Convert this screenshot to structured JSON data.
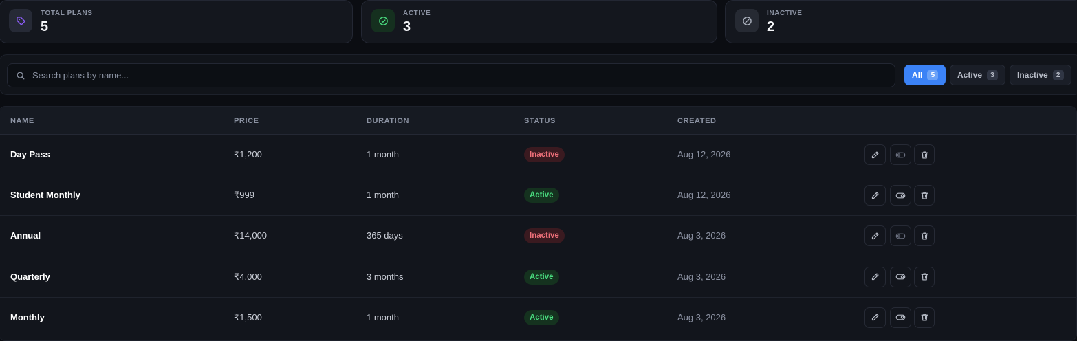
{
  "stats": [
    {
      "label": "TOTAL PLANS",
      "value": "5",
      "icon": "tag-icon",
      "accent": "#8b5cf6"
    },
    {
      "label": "ACTIVE",
      "value": "3",
      "icon": "check-circle-icon",
      "accent": "#4ade80"
    },
    {
      "label": "INACTIVE",
      "value": "2",
      "icon": "ban-circle-icon",
      "accent": "#9ca3af"
    }
  ],
  "search": {
    "placeholder": "Search plans by name..."
  },
  "filters": [
    {
      "label": "All",
      "count": "5",
      "selected": true
    },
    {
      "label": "Active",
      "count": "3",
      "selected": false
    },
    {
      "label": "Inactive",
      "count": "2",
      "selected": false
    }
  ],
  "table": {
    "columns": [
      "NAME",
      "PRICE",
      "DURATION",
      "STATUS",
      "CREATED"
    ],
    "rows": [
      {
        "name": "Day Pass",
        "price": "₹1,200",
        "duration": "1 month",
        "status": "Inactive",
        "created": "Aug 12, 2026"
      },
      {
        "name": "Student Monthly",
        "price": "₹999",
        "duration": "1 month",
        "status": "Active",
        "created": "Aug 12, 2026"
      },
      {
        "name": "Annual",
        "price": "₹14,000",
        "duration": "365 days",
        "status": "Inactive",
        "created": "Aug 3, 2026"
      },
      {
        "name": "Quarterly",
        "price": "₹4,000",
        "duration": "3 months",
        "status": "Active",
        "created": "Aug 3, 2026"
      },
      {
        "name": "Monthly",
        "price": "₹1,500",
        "duration": "1 month",
        "status": "Active",
        "created": "Aug 3, 2026"
      }
    ],
    "row_actions": [
      "pencil-icon",
      "toggle-icon",
      "trash-icon"
    ]
  },
  "colors": {
    "primary": "#3b82f6",
    "active": "#4ade80",
    "inactive": "#f0707a"
  }
}
